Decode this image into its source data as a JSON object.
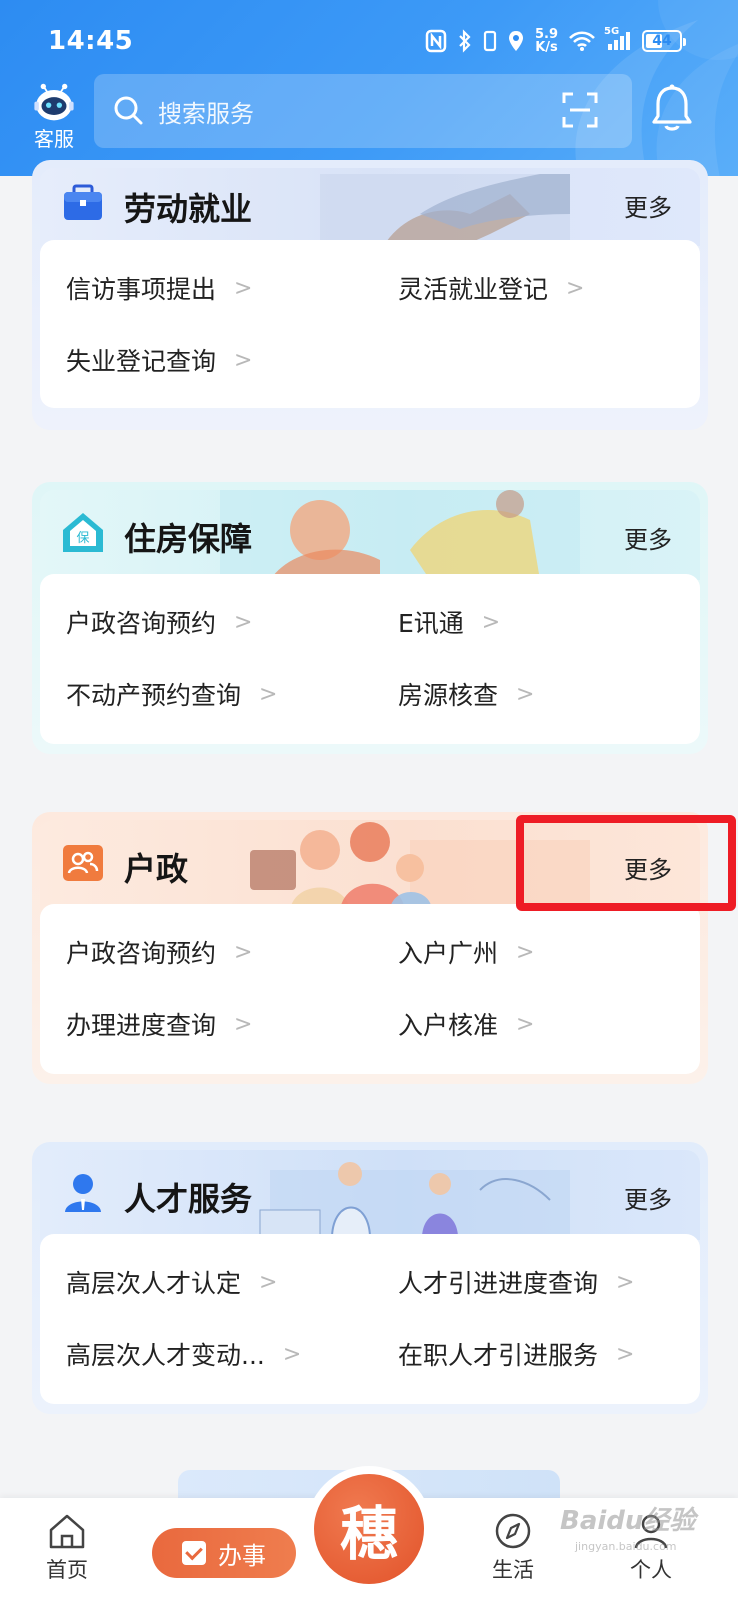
{
  "status_bar": {
    "time": "14:45",
    "net_speed_value": "5.9",
    "net_speed_unit": "K/s",
    "battery": "44",
    "signal_label": "5G"
  },
  "header": {
    "kefu_label": "客服",
    "search_placeholder": "搜索服务"
  },
  "sections": {
    "labor": {
      "title": "劳动就业",
      "more": "更多",
      "items": [
        "信访事项提出",
        "灵活就业登记",
        "失业登记查询"
      ]
    },
    "housing": {
      "title": "住房保障",
      "more": "更多",
      "icon_text": "保",
      "items": [
        "户政咨询预约",
        "E讯通",
        "不动产预约查询",
        "房源核查"
      ]
    },
    "hukou": {
      "title": "户政",
      "more": "更多",
      "items": [
        "户政咨询预约",
        "入户广州",
        "办理进度查询",
        "入户核准"
      ]
    },
    "talent": {
      "title": "人才服务",
      "more": "更多",
      "items": [
        "高层次人才认定",
        "人才引进进度查询",
        "高层次人才变动...",
        "在职人才引进服务"
      ]
    }
  },
  "bottom_nav": {
    "home": "首页",
    "banshi": "办事",
    "center_glyph": "穗",
    "life": "生活",
    "me": "个人"
  },
  "watermark": {
    "text": "Baidu经验",
    "sub": "jingyan.baidu.com"
  },
  "colors": {
    "header_blue": "#2d8cf2",
    "accent_orange": "#e9693e",
    "highlight_red": "#ee1c25"
  }
}
